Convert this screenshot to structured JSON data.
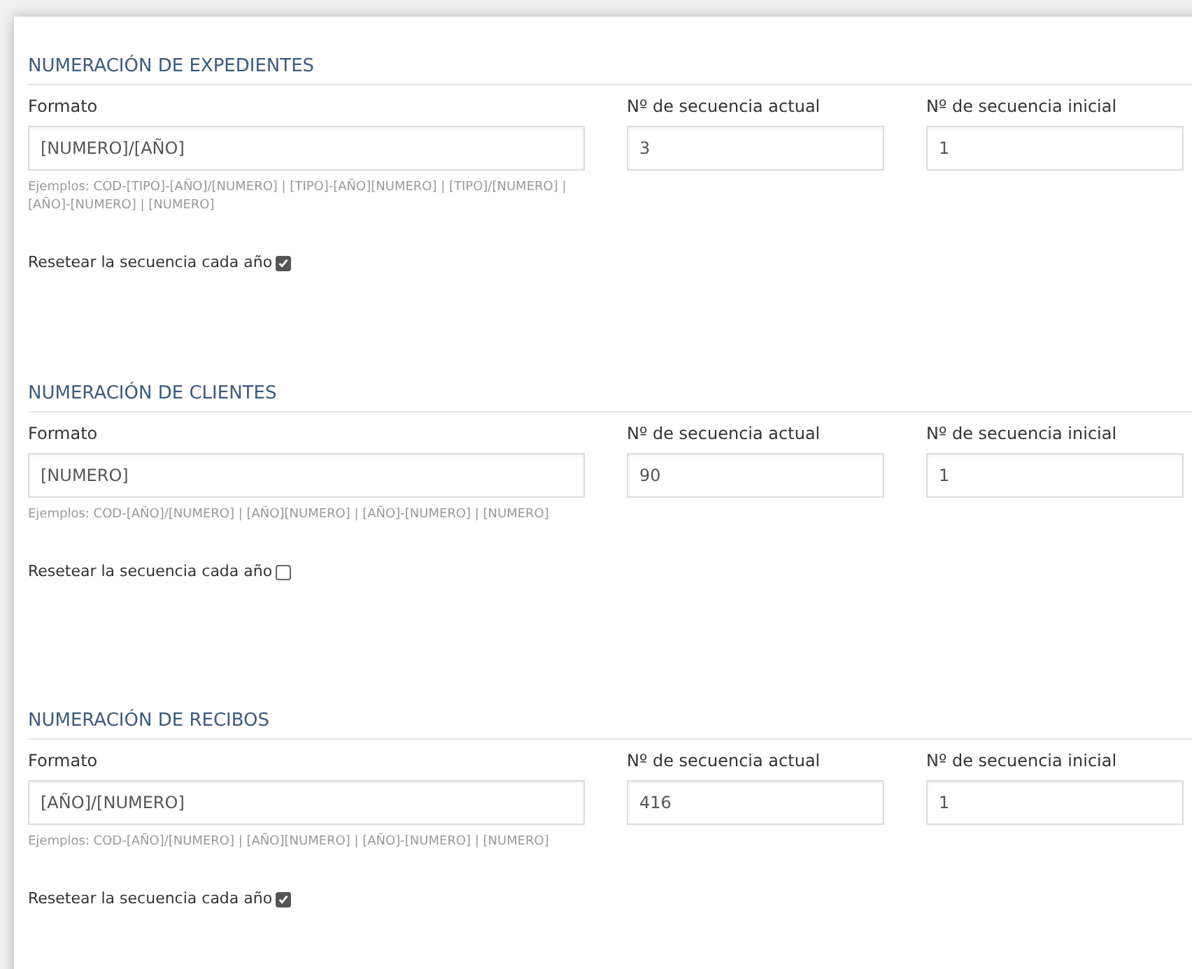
{
  "sections": [
    {
      "title": "NUMERACIÓN DE EXPEDIENTES",
      "format_label": "Formato",
      "format_value": "[NUMERO]/[AÑO]",
      "examples": "Ejemplos: COD-[TIPO]-[AÑO]/[NUMERO] | [TIPO]-[AÑO][NUMERO] | [TIPO]/[NUMERO] | [AÑO]-[NUMERO] | [NUMERO]",
      "current_label": "Nº de secuencia actual",
      "current_value": "3",
      "initial_label": "Nº de secuencia inicial",
      "initial_value": "1",
      "reset_label": "Resetear la secuencia cada año",
      "reset_checked": true
    },
    {
      "title": "NUMERACIÓN DE CLIENTES",
      "format_label": "Formato",
      "format_value": "[NUMERO]",
      "examples": "Ejemplos: COD-[AÑO]/[NUMERO] | [AÑO][NUMERO] | [AÑO]-[NUMERO] | [NUMERO]",
      "current_label": "Nº de secuencia actual",
      "current_value": "90",
      "initial_label": "Nº de secuencia inicial",
      "initial_value": "1",
      "reset_label": "Resetear la secuencia cada año",
      "reset_checked": false
    },
    {
      "title": "NUMERACIÓN DE RECIBOS",
      "format_label": "Formato",
      "format_value": "[AÑO]/[NUMERO]",
      "examples": "Ejemplos: COD-[AÑO]/[NUMERO] | [AÑO][NUMERO] | [AÑO]-[NUMERO] | [NUMERO]",
      "current_label": "Nº de secuencia actual",
      "current_value": "416",
      "initial_label": "Nº de secuencia inicial",
      "initial_value": "1",
      "reset_label": "Resetear la secuencia cada año",
      "reset_checked": true
    }
  ]
}
